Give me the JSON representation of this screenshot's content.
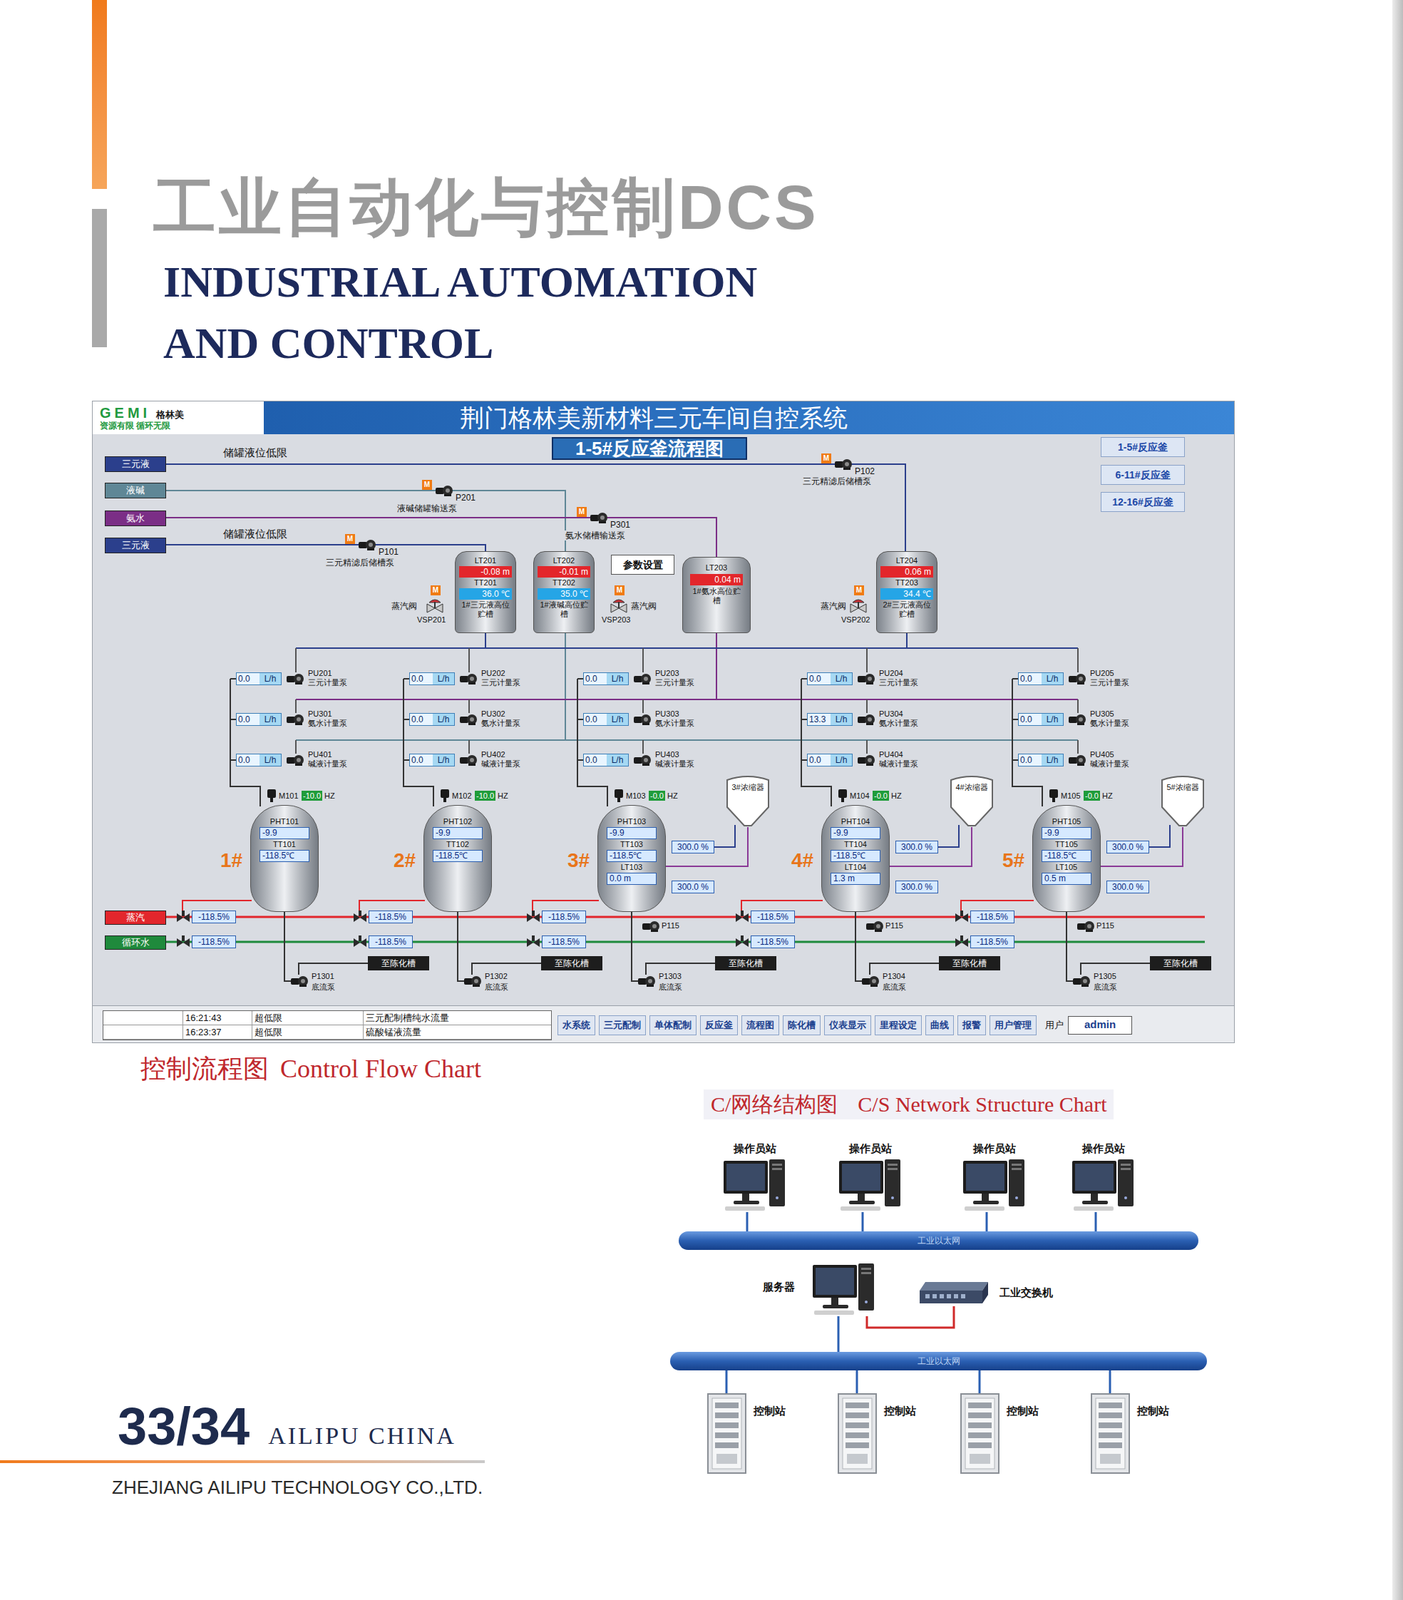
{
  "page": {
    "title_cn": "工业自动化与控制DCS",
    "title_en_1": "INDUSTRIAL AUTOMATION",
    "title_en_2": "AND CONTROL",
    "caption_cn": "控制流程图",
    "caption_en": "Control Flow Chart"
  },
  "scada": {
    "logo": {
      "mark": "GEMI",
      "name": "格林美",
      "slogan": "资源有限 循环无限"
    },
    "title": "荆门格林美新材料三元车间自控系统",
    "subtitle": "1-5#反应釜流程图",
    "nav": [
      {
        "label": "1-5#反应釜",
        "selected": false
      },
      {
        "label": "6-11#反应釜",
        "selected": false
      },
      {
        "label": "12-16#反应釜",
        "selected": false
      }
    ],
    "inputs": [
      {
        "label": "三元液",
        "color": "#2b3f8c"
      },
      {
        "label": "液碱",
        "color": "#5f8796"
      },
      {
        "label": "氨水",
        "color": "#7b2e86"
      },
      {
        "label": "三元液",
        "color": "#2b3f8c"
      }
    ],
    "low_limit_labels": [
      "储罐液位低限",
      "储罐液位低限"
    ],
    "motor_badge": "M",
    "transfer_pumps": [
      {
        "tag": "P201",
        "label": "液碱储罐输送泵"
      },
      {
        "tag": "P101",
        "label": "三元精滤后储槽泵"
      },
      {
        "tag": "P301",
        "label": "氨水储槽输送泵"
      },
      {
        "tag": "P102",
        "label": "三元精滤后储槽泵"
      }
    ],
    "settings_button": "参数设置",
    "head_tanks": [
      {
        "kind": "full",
        "level_tag": "LT201",
        "level": "-0.08 m",
        "temp_tag": "TT201",
        "temp": "36.0 ℃",
        "name": "1#三元液高位贮槽"
      },
      {
        "kind": "full",
        "level_tag": "LT202",
        "level": "-0.01 m",
        "temp_tag": "TT202",
        "temp": "35.0 ℃",
        "name": "1#液碱高位贮槽"
      },
      {
        "kind": "level",
        "level_tag": "LT203",
        "level": "0.04 m",
        "name": "1#氨水高位贮槽"
      },
      {
        "kind": "full",
        "level_tag": "LT204",
        "level": "0.06 m",
        "temp_tag": "TT203",
        "temp": "34.4 ℃",
        "name": "2#三元液高位贮槽"
      }
    ],
    "steam_valves": [
      {
        "label": "蒸汽阀",
        "tag": "VSP201"
      },
      {
        "label": "蒸汽阀",
        "tag": "VSP203"
      },
      {
        "label": "蒸汽阀",
        "tag": "VSP202"
      }
    ],
    "utilities": [
      {
        "label": "蒸汽",
        "color": "#e2262c"
      },
      {
        "label": "循环水",
        "color": "#1f8a3c"
      }
    ],
    "reactors": [
      {
        "id": "1#",
        "kind": "basic",
        "motor_tag": "M101",
        "freq": "-10.0",
        "freq_unit": "HZ",
        "ph_tag": "PHT101",
        "ph": "-9.9",
        "temp_tag": "TT101",
        "temp": "-118.5℃",
        "pumps": [
          {
            "reading": "0.0",
            "unit": "L/h",
            "tag": "PU201",
            "label": "三元计量泵"
          },
          {
            "reading": "0.0",
            "unit": "L/h",
            "tag": "PU301",
            "label": "氨水计量泵"
          },
          {
            "reading": "0.0",
            "unit": "L/h",
            "tag": "PU401",
            "label": "碱液计量泵"
          }
        ],
        "steam_valve": "-118.5%",
        "water_valve": "-118.5%",
        "bottom_pump_tag": "P1301",
        "bottom_pump_label": "底流泵",
        "outlet": "至陈化槽"
      },
      {
        "id": "2#",
        "kind": "basic",
        "motor_tag": "M102",
        "freq": "-10.0",
        "freq_unit": "HZ",
        "ph_tag": "PHT102",
        "ph": "-9.9",
        "temp_tag": "TT102",
        "temp": "-118.5℃",
        "pumps": [
          {
            "reading": "0.0",
            "unit": "L/h",
            "tag": "PU202",
            "label": "三元计量泵"
          },
          {
            "reading": "0.0",
            "unit": "L/h",
            "tag": "PU302",
            "label": "氨水计量泵"
          },
          {
            "reading": "0.0",
            "unit": "L/h",
            "tag": "PU402",
            "label": "碱液计量泵"
          }
        ],
        "steam_valve": "-118.5%",
        "water_valve": "-118.5%",
        "bottom_pump_tag": "P1302",
        "bottom_pump_label": "底流泵",
        "outlet": "至陈化槽"
      },
      {
        "id": "3#",
        "kind": "full",
        "motor_tag": "M103",
        "freq": "-0.0",
        "freq_unit": "HZ",
        "ph_tag": "PHT103",
        "ph": "-9.9",
        "temp_tag": "TT103",
        "temp": "-118.5℃",
        "level_tag": "LT103",
        "level": "0.0 m",
        "outputs": [
          "300.0 %",
          "300.0 %"
        ],
        "concentrator": "3#浓缩器",
        "recycle_pump": "P115",
        "pumps": [
          {
            "reading": "0.0",
            "unit": "L/h",
            "tag": "PU203",
            "label": "三元计量泵"
          },
          {
            "reading": "0.0",
            "unit": "L/h",
            "tag": "PU303",
            "label": "氨水计量泵"
          },
          {
            "reading": "0.0",
            "unit": "L/h",
            "tag": "PU403",
            "label": "碱液计量泵"
          }
        ],
        "steam_valve": "-118.5%",
        "water_valve": "-118.5%",
        "bottom_pump_tag": "P1303",
        "bottom_pump_label": "底流泵",
        "outlet": "至陈化槽"
      },
      {
        "id": "4#",
        "kind": "full",
        "motor_tag": "M104",
        "freq": "-0.0",
        "freq_unit": "HZ",
        "ph_tag": "PHT104",
        "ph": "-9.9",
        "temp_tag": "TT104",
        "temp": "-118.5℃",
        "level_tag": "LT104",
        "level": "1.3 m",
        "outputs": [
          "300.0 %",
          "300.0 %"
        ],
        "concentrator": "4#浓缩器",
        "recycle_pump": "P115",
        "pumps": [
          {
            "reading": "0.0",
            "unit": "L/h",
            "tag": "PU204",
            "label": "三元计量泵"
          },
          {
            "reading": "13.3",
            "unit": "L/h",
            "tag": "PU304",
            "label": "氨水计量泵"
          },
          {
            "reading": "0.0",
            "unit": "L/h",
            "tag": "PU404",
            "label": "碱液计量泵"
          }
        ],
        "steam_valve": "-118.5%",
        "water_valve": "-118.5%",
        "bottom_pump_tag": "P1304",
        "bottom_pump_label": "底流泵",
        "outlet": "至陈化槽"
      },
      {
        "id": "5#",
        "kind": "full",
        "motor_tag": "M105",
        "freq": "-0.0",
        "freq_unit": "HZ",
        "ph_tag": "PHT105",
        "ph": "-9.9",
        "temp_tag": "TT105",
        "temp": "-118.5℃",
        "level_tag": "LT105",
        "level": "0.5 m",
        "outputs": [
          "300.0 %",
          "300.0 %"
        ],
        "concentrator": "5#浓缩器",
        "recycle_pump": "P115",
        "pumps": [
          {
            "reading": "0.0",
            "unit": "L/h",
            "tag": "PU205",
            "label": "三元计量泵"
          },
          {
            "reading": "0.0",
            "unit": "L/h",
            "tag": "PU305",
            "label": "氨水计量泵"
          },
          {
            "reading": "0.0",
            "unit": "L/h",
            "tag": "PU405",
            "label": "碱液计量泵"
          }
        ],
        "steam_valve": "-118.5%",
        "water_valve": "-118.5%",
        "bottom_pump_tag": "P1305",
        "bottom_pump_label": "底流泵",
        "outlet": "至陈化槽"
      }
    ],
    "alarms": [
      {
        "time": "16:21:43",
        "type": "超低限",
        "message": "三元配制槽纯水流量"
      },
      {
        "time": "16:23:37",
        "type": "超低限",
        "message": "硫酸锰液流量"
      }
    ],
    "menu": [
      "水系统",
      "三元配制",
      "单体配制",
      "反应釜",
      "流程图",
      "陈化槽",
      "仪表显示",
      "里程设定",
      "曲线",
      "报警",
      "用户管理"
    ],
    "user": {
      "label": "用户",
      "value": "admin"
    }
  },
  "network": {
    "title_cn": "C/网络结构图",
    "title_en": "C/S Network Structure Chart",
    "operators": [
      "操作员站",
      "操作员站",
      "操作员站",
      "操作员站"
    ],
    "bus_labels": [
      "工业以太网",
      "工业以太网"
    ],
    "server": "服务器",
    "switch": "工业交换机",
    "controllers": [
      "控制站",
      "控制站",
      "控制站",
      "控制站"
    ]
  },
  "footer": {
    "page_no": "33/34",
    "brand": "AILIPU CHINA",
    "company": "ZHEJIANG AILIPU TECHNOLOGY CO.,LTD."
  }
}
